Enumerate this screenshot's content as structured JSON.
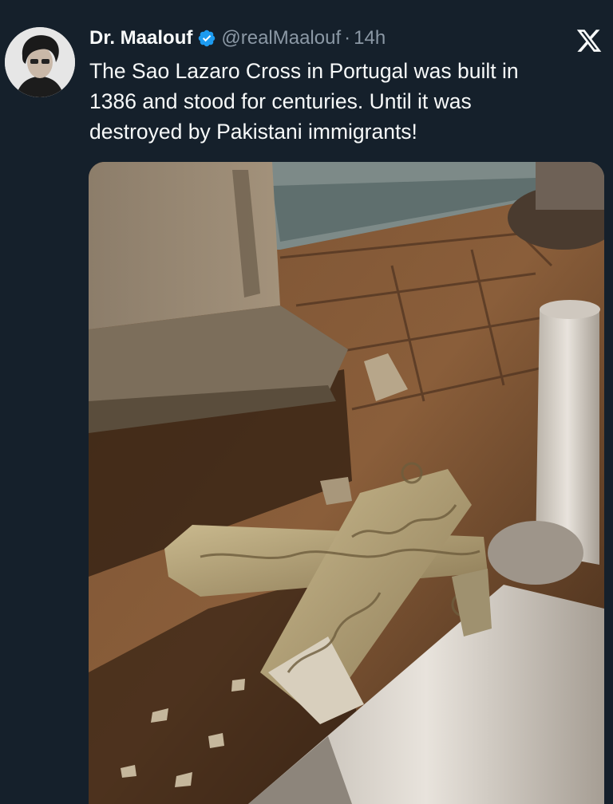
{
  "author": {
    "display_name": "Dr. Maalouf",
    "handle": "@realMaalouf",
    "separator": "·",
    "time": "14h",
    "verified_icon": "verified-badge-icon",
    "avatar_icon": "profile-avatar"
  },
  "tweet": {
    "text_lines": [
      "The Sao Lazaro Cross in Portugal was built in",
      "1386 and stood for centuries. Until it was",
      "destroyed by Pakistani immigrants!"
    ]
  },
  "media": {
    "kind": "photo",
    "subject": "toppled-stone-cross"
  },
  "platform": {
    "logo_icon": "x-logo-icon"
  },
  "colors": {
    "background": "#15202b",
    "text": "#f7f9f9",
    "secondary_text": "#8b98a5",
    "verified": "#1d9bf0"
  }
}
